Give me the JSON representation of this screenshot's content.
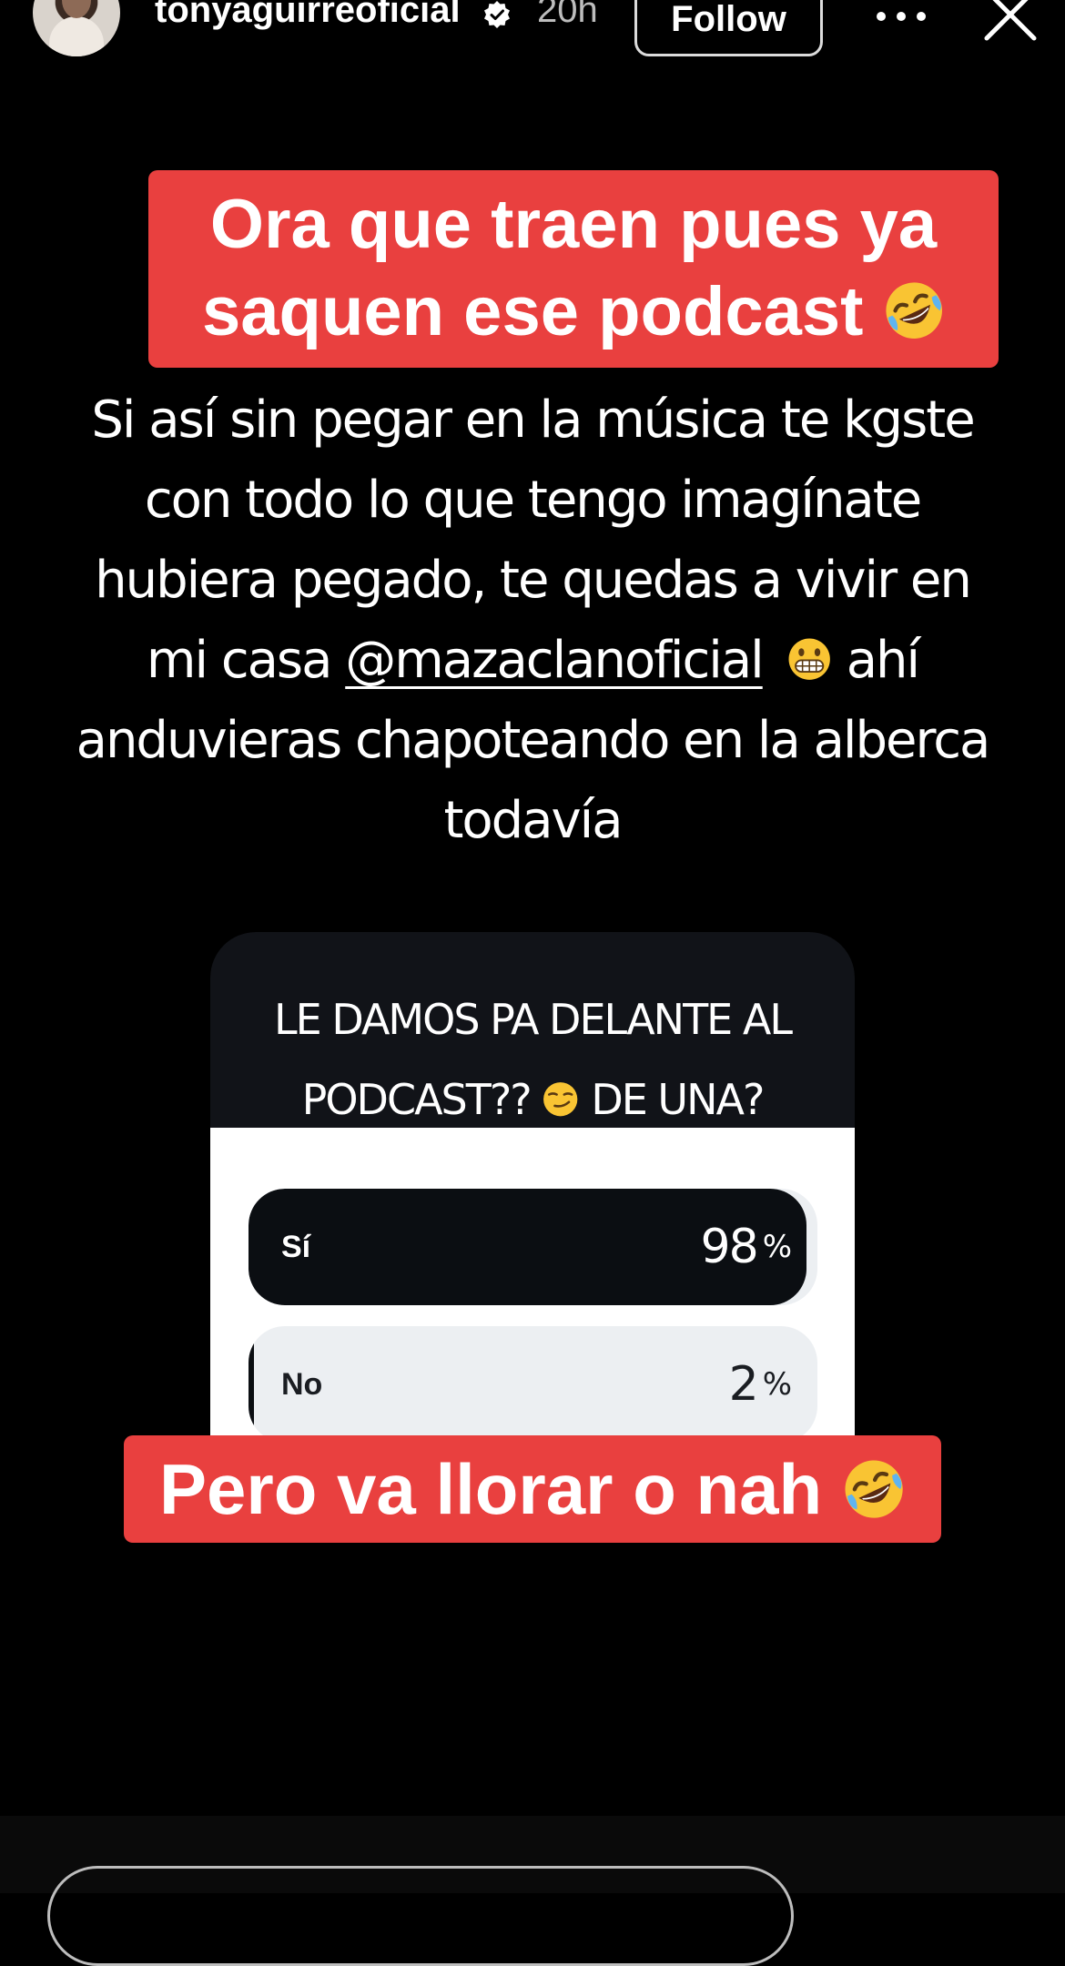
{
  "header": {
    "username": "tonyaguirreoficial",
    "time": "20h",
    "follow_label": "Follow"
  },
  "top_caption": {
    "line1": "Ora que traen pues ya",
    "line2": "saquen ese podcast"
  },
  "body_text": {
    "line1": "Si así sin pegar en la música te kgste",
    "line2": "con todo lo que tengo imagínate",
    "line3": "hubiera pegado, te quedas a vivir en",
    "line4_before": "mi casa ",
    "mention": "@mazaclanoficial",
    "line4_after": " ahí",
    "line5": "anduvieras chapoteando en la alberca",
    "line6": "todavía"
  },
  "poll": {
    "question_line1": "LE DAMOS PA DELANTE AL",
    "question_line2_before": "PODCAST?? ",
    "question_line2_after": " DE UNA?",
    "options": [
      {
        "label": "Sí",
        "percent": 98,
        "percent_text": "98",
        "fill_fraction": 0.98
      },
      {
        "label": "No",
        "percent": 2,
        "percent_text": "2",
        "fill_fraction": 0.02
      }
    ],
    "percent_sign": "%"
  },
  "bottom_caption": {
    "text": "Pero va llorar o nah"
  },
  "icons": [
    "verified-icon",
    "more-icon",
    "close-icon",
    "rofl-emoji",
    "grimacing-emoji",
    "smirk-emoji"
  ],
  "colors": {
    "caption_red": "#e9403f",
    "poll_dark": "#0b0e12",
    "poll_light": "#eceff2"
  }
}
